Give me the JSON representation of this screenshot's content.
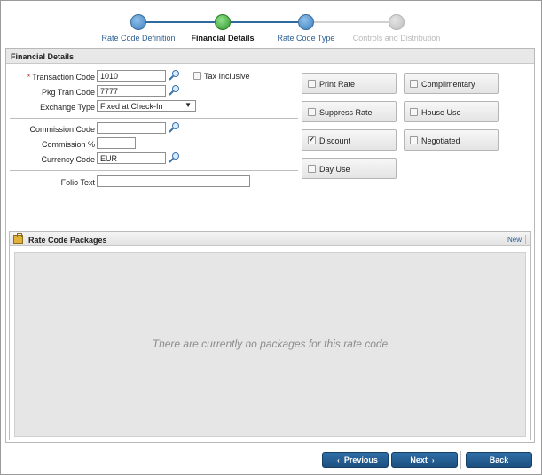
{
  "wizard": {
    "steps": [
      {
        "label": "Rate Code Definition",
        "state": "link"
      },
      {
        "label": "Financial Details",
        "state": "active"
      },
      {
        "label": "Rate Code Type",
        "state": "link"
      },
      {
        "label": "Controls and Distribution",
        "state": "disabled"
      }
    ]
  },
  "panel": {
    "title": "Financial Details",
    "fields": {
      "transaction_code": {
        "label": "Transaction Code",
        "value": "1010",
        "required": "*"
      },
      "tax_inclusive": {
        "label": "Tax Inclusive",
        "checked": false
      },
      "pkg_tran_code": {
        "label": "Pkg Tran Code",
        "value": "7777"
      },
      "exchange_type": {
        "label": "Exchange Type",
        "value": "Fixed at Check-In"
      },
      "commission_code": {
        "label": "Commission Code",
        "value": ""
      },
      "commission_pct": {
        "label": "Commission %",
        "value": ""
      },
      "currency_code": {
        "label": "Currency Code",
        "value": "EUR"
      },
      "folio_text": {
        "label": "Folio Text",
        "value": ""
      }
    },
    "options": [
      {
        "label": "Print Rate",
        "checked": false
      },
      {
        "label": "Complimentary",
        "checked": false
      },
      {
        "label": "Suppress Rate",
        "checked": false
      },
      {
        "label": "House Use",
        "checked": false
      },
      {
        "label": "Discount",
        "checked": true
      },
      {
        "label": "Negotiated",
        "checked": false
      },
      {
        "label": "Day Use",
        "checked": false
      }
    ]
  },
  "packages": {
    "title": "Rate Code Packages",
    "new_label": "New",
    "empty_message": "There are currently no packages for this rate code"
  },
  "footer": {
    "previous_label": "Previous",
    "next_label": "Next",
    "back_label": "Back"
  },
  "colors": {
    "accent": "#2e6ea6",
    "step_active": "#2f9a2c",
    "step_done": "#3d7fbf",
    "step_disabled": "#bdbdbd",
    "required": "#c0392b"
  },
  "icons": {
    "lookup": "magnifier-icon",
    "package": "package-icon",
    "chevron_left": "chevron-left-icon",
    "chevron_right": "chevron-right-icon"
  }
}
